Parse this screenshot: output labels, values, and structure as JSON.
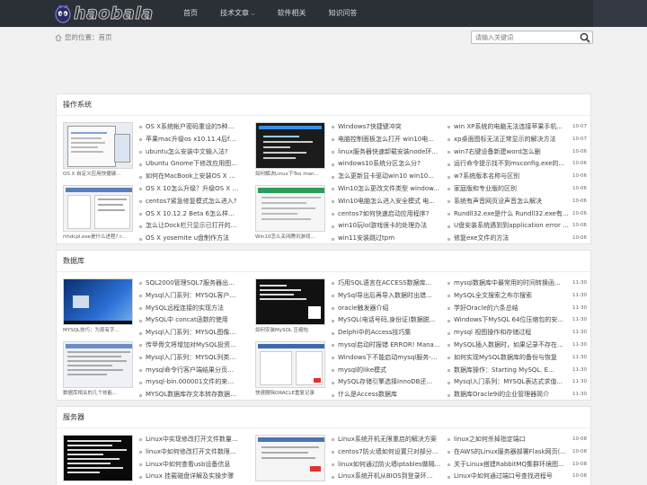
{
  "header": {
    "logo_text": "haobala",
    "nav": [
      "首页",
      "技术文章",
      "软件相关",
      "知识问答"
    ]
  },
  "breadcrumb": {
    "label": "您的位置：",
    "home": "首页"
  },
  "search": {
    "placeholder": "请输入关键词"
  },
  "sections": [
    {
      "title": "操作系统",
      "thumbs": [
        {
          "caption": "OS X 自定义应用快捷键..."
        },
        {
          "caption": "如何解决Linux下Too man..."
        },
        {
          "caption": "rthdcpl.exe是什么进程? r..."
        },
        {
          "caption": "Win10怎么关闭腾讯游戏..."
        }
      ],
      "col1": [
        "OS X系统帐户密码重设的5种方法",
        "苹果mac升级os x10.11.4后faceti...",
        "ubuntu怎么安装中文输入法?",
        "Ubuntu Gnome下修改应用图标ic...",
        "如何在MacBook上安装OS X 10...",
        "OS X 10怎么升级？升级OS X 10...",
        "centos7紧急修复模式怎么进入?",
        "OS X 10.12.2 Beta 6怎么样？O...",
        "怎么让Dock栏只显示已打开的应...",
        "OS X yosemite u盘制作方法"
      ],
      "col2": [
        "Windows7快捷键冲突",
        "电脑控制面板怎么打开 win10电...",
        "linux服务器快速卸载安装node环...",
        "windows10系统分区怎么分?",
        "怎么更新显卡驱动win10 win10...",
        "Win10怎么更改文件类型 window...",
        "Win10电脑怎么进入安全模式 电...",
        "centos7如何快速启动应用程序?",
        "win10玩lol游戏很卡的处理办法",
        "win11安装跳过tpm"
      ],
      "col3": [
        [
          "win XP系统的电脑无法连接苹果手机...",
          "10-07"
        ],
        [
          "xp桌面图标无法正常显示的解决方法",
          "10-07"
        ],
        [
          "win7右键设备新建word怎么删",
          "10-06"
        ],
        [
          "运行命令提示找不到msconfig.exe的...",
          "10-06"
        ],
        [
          "w7系统版本名称与区别",
          "10-06"
        ],
        [
          "家庭版和专业版的区别",
          "10-06"
        ],
        [
          "系统有声音网页没声音怎么解决",
          "10-06"
        ],
        [
          "Rundll32.exe是什么 Rundll32.exe有...",
          "10-06"
        ],
        [
          "U盘安装系统遇到到application error ...",
          "10-06"
        ],
        [
          "修复exe文件的方法",
          "10-06"
        ]
      ]
    },
    {
      "title": "数据库",
      "thumbs": [
        {
          "caption": "MYSQL技巧：为现有字..."
        },
        {
          "caption": "如何安装MySQL 压缩包"
        },
        {
          "caption": "数据库相关的几个技能..."
        },
        {
          "caption": "快速删除ORACLE重复记录"
        }
      ],
      "col1": [
        "SQL2000管理SQL7服务器出现T...",
        "Mysql入门系列：MYSQL客户机...",
        "MySQL远程连接的实现方法",
        "MySQL中 concat函数的使用",
        "Mysql入门系列：MYSQL图像数...",
        "传甲骨文将增加对MySQL投资与...",
        "Mysql入门系列：MYSQL列类型...",
        "mysql命令行客户端结果分页浏览",
        "mysql-bin.000001文件的来源及...",
        "MYSQL数据库存文本转存数据库..."
      ],
      "col2": [
        "巧用SQL语言在ACCESS数据库...",
        "MySql导出后再导入数据时出错...",
        "oracle触发器介绍",
        "MySQL(电话号码,身份证)数据脱...",
        "Delphi中的Access技巧集",
        "mysql启动时报错 ERROR! Mana...",
        "Windows下不能启动mysql服务-...",
        "mysql的like模式",
        "MySQL存储引擎选择InnoDB还...",
        "什么是Access数据库"
      ],
      "col3": [
        [
          "mysql数据库中最常用的时间转换函...",
          "11-30"
        ],
        [
          "MySQL全文搜索之布尔搜索",
          "11-30"
        ],
        [
          "学好Oracle的六条总结",
          "11-30"
        ],
        [
          "Windows下MySQL 64位压缩包的安...",
          "11-30"
        ],
        [
          "mysql 视图操作和存储过程",
          "11-30"
        ],
        [
          "MySQL插入数据时，如果记录不存在...",
          "11-30"
        ],
        [
          "如何实现MySQL数据库的备份与恢复",
          "11-30"
        ],
        [
          "数据库操作：Starting MySQL. E...",
          "11-30"
        ],
        [
          "Mysql入门系列：MYSQL表达式求值...",
          "11-30"
        ],
        [
          "数据库Oracle9i的企业管理器简介",
          "11-30"
        ]
      ]
    },
    {
      "title": "服务器",
      "thumbs": [
        {
          "caption": ""
        },
        {
          "caption": ""
        }
      ],
      "col1": [
        "Linux中实现修改打开文件数量和...",
        "linux中如何修改打开文件数限制...",
        "Linux中如何查看usb设备信息",
        "Linux 挂载磁盘详解及实操步骤"
      ],
      "col2": [
        "Linux系统开机无限重启的解决方案",
        "centos7防火墙如何设置只对部分...",
        "linux如何通过防火墙iptables做隔...",
        "Linux系统开机从BIOS到登录环..."
      ],
      "col3": [
        [
          "linux之如何杀掉指定端口",
          "10-08"
        ],
        [
          "在AWS的Linux服务器部署Flask网页(...",
          "10-08"
        ],
        [
          "关于Linux搭建RabbitMQ集群环境图...",
          "10-08"
        ],
        [
          "Linux中如何通过端口号查找进程号",
          "10-08"
        ]
      ]
    }
  ]
}
